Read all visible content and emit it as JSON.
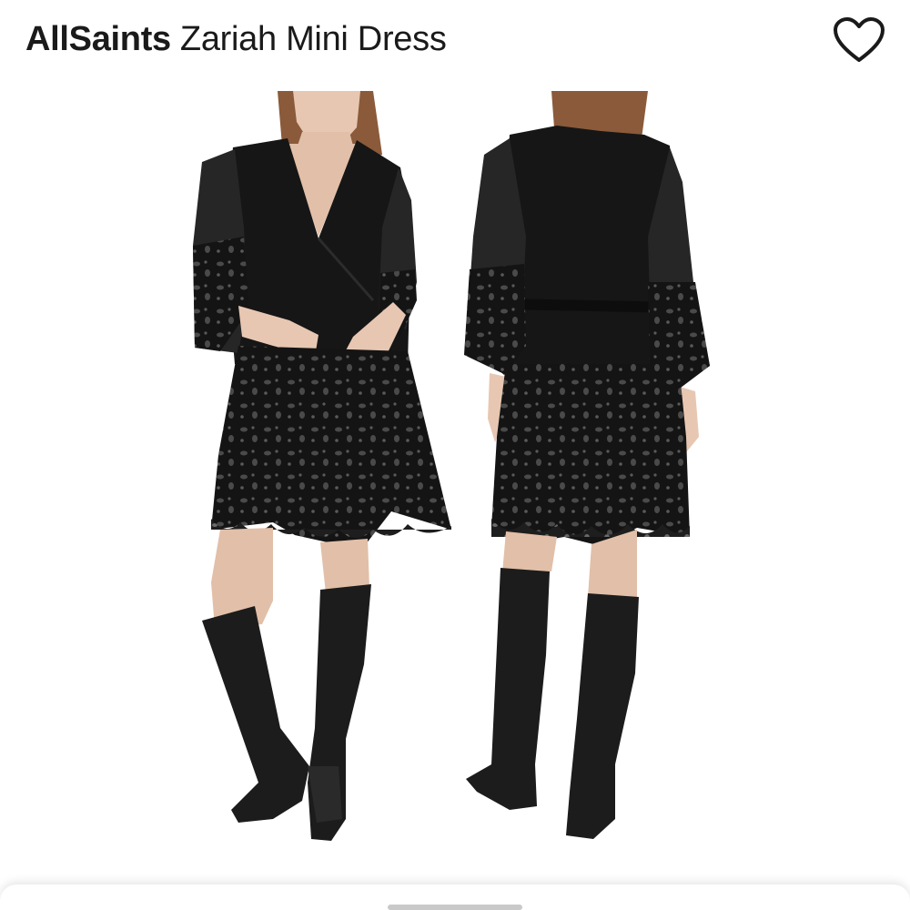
{
  "header": {
    "brand": "AllSaints",
    "product_name": "Zariah Mini Dress",
    "favorite_icon": "heart-outline-icon"
  },
  "colors": {
    "text": "#1a1a1a",
    "background": "#ffffff",
    "dress": "#151515",
    "boots": "#1c1c1c",
    "skin": "#e7c7b2",
    "hair": "#8a5a3a"
  },
  "bottom_sheet": {
    "handle_icon": "drag-handle"
  }
}
